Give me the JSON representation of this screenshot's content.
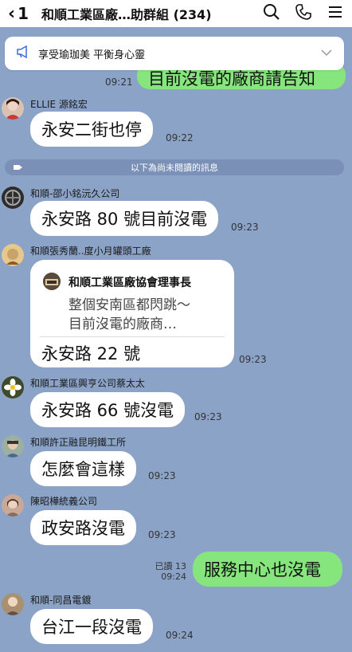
{
  "header": {
    "back_count": "1",
    "title": "和順工業區廠…助群組 (234)"
  },
  "notice": {
    "text": "享受瑜珈美 平衡身心靈"
  },
  "top_partial": {
    "text": "目前沒電的廠商請告知",
    "time": "09:21"
  },
  "divider": {
    "text": "以下為尚未閱讀的訊息"
  },
  "messages": [
    {
      "sender": "ELLIE 源銘宏",
      "text": "永安二街也停",
      "time": "09:22"
    },
    {
      "sender": "和順-邵小銘沅久公司",
      "text": "永安路 80 號目前沒電",
      "time": "09:23"
    },
    {
      "sender": "和順張秀蘭..度小月罐頭工廠",
      "text": "永安路 22 號",
      "time": "09:23",
      "quote": {
        "author": "和順工業區廠協會理事長",
        "line1": "整個安南區都閃跳～",
        "line2": "目前沒電的廠商…"
      }
    },
    {
      "sender": "和順工業區興亨公司蔡太太",
      "text": "永安路 66 號沒電",
      "time": "09:23"
    },
    {
      "sender": "和順許正融昆明鐵工所",
      "text": "怎麼會這樣",
      "time": "09:23"
    },
    {
      "sender": "陳昭樺統義公司",
      "text": "政安路沒電",
      "time": "09:23"
    },
    {
      "sender": "和順-同昌電鍍",
      "text": "台江一段沒電",
      "time": "09:24"
    }
  ],
  "own_message": {
    "text": "服務中心也沒電",
    "read": "已讀 13",
    "time": "09:24"
  },
  "colors": {
    "background": "#8ca3c8",
    "own_bubble": "#86e57d",
    "other_bubble": "#ffffff"
  },
  "icons": [
    "chevron-left-icon",
    "search-icon",
    "phone-icon",
    "menu-icon",
    "megaphone-icon",
    "chevron-down-icon",
    "tag-icon"
  ]
}
